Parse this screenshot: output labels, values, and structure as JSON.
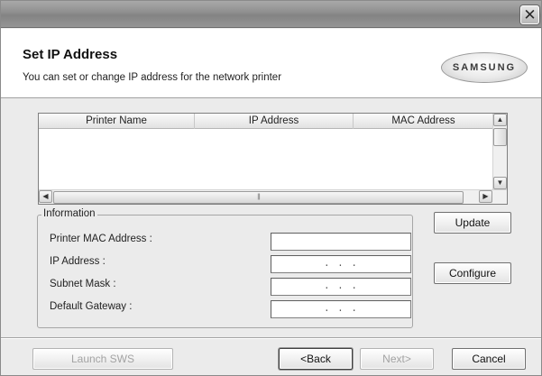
{
  "window": {
    "close_glyph": "✕"
  },
  "header": {
    "title": "Set IP Address",
    "subtitle": "You can set or change IP address for the network printer",
    "logo_text": "SAMSUNG"
  },
  "printer_table": {
    "columns": [
      "Printer Name",
      "IP Address",
      "MAC Address"
    ],
    "rows": [],
    "scroll_up_icon": "scroll-up-arrow",
    "scroll_down_icon": "scroll-down-arrow",
    "scroll_left_icon": "scroll-left-arrow",
    "scroll_right_icon": "scroll-right-arrow",
    "up_glyph": "▲",
    "down_glyph": "▼",
    "left_glyph": "◀",
    "right_glyph": "▶",
    "hthumb_grip": "|||"
  },
  "information": {
    "legend": "Information",
    "fields": [
      {
        "label": "Printer MAC Address :",
        "value": ""
      },
      {
        "label": "IP Address :",
        "value": ".     .     ."
      },
      {
        "label": "Subnet Mask :",
        "value": ".     .     ."
      },
      {
        "label": "Default Gateway :",
        "value": ".     .     ."
      }
    ]
  },
  "side_buttons": {
    "update_label": "Update",
    "configure_label": "Configure"
  },
  "footer": {
    "launch_label": "Launch SWS",
    "back_label": "<Back",
    "next_label": "Next>",
    "cancel_label": "Cancel"
  },
  "colors": {
    "dialog_bg": "#ebebeb",
    "titlebar": "#8e8e8e",
    "header_bg": "#ffffff"
  }
}
